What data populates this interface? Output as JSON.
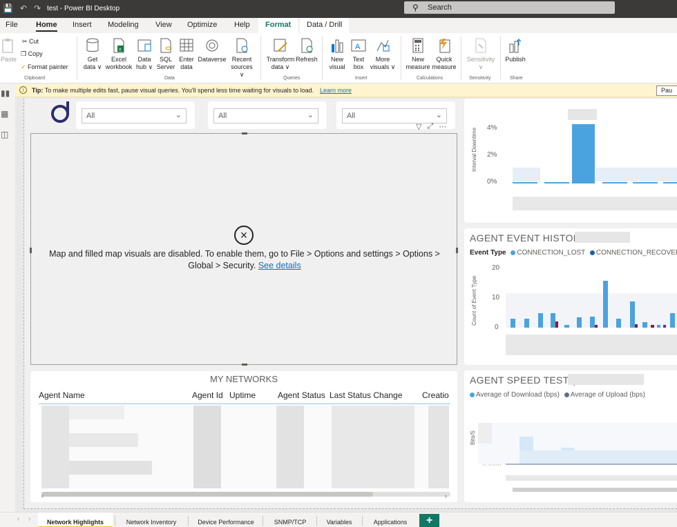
{
  "titlebar": {
    "title": "test - Power BI Desktop",
    "search_placeholder": "Search"
  },
  "menu": {
    "items": [
      "File",
      "Home",
      "Insert",
      "Modeling",
      "View",
      "Optimize",
      "Help"
    ],
    "active": "Home",
    "context_tabs": [
      "Format",
      "Data / Drill"
    ]
  },
  "ribbon": {
    "clipboard": {
      "paste": "Paste",
      "cut": "Cut",
      "copy": "Copy",
      "format_painter": "Format painter",
      "label": "Clipboard"
    },
    "data": {
      "get_data": [
        "Get",
        "data ∨"
      ],
      "excel": [
        "Excel",
        "workbook"
      ],
      "data_hub": [
        "Data",
        "hub ∨"
      ],
      "sql": [
        "SQL",
        "Server"
      ],
      "enter_data": [
        "Enter",
        "data"
      ],
      "dataverse": "Dataverse",
      "recent": [
        "Recent",
        "sources ∨"
      ],
      "label": "Data"
    },
    "queries": {
      "transform": [
        "Transform",
        "data ∨"
      ],
      "refresh": "Refresh",
      "label": "Queries"
    },
    "insert": {
      "new_visual": [
        "New",
        "visual"
      ],
      "text_box": [
        "Text",
        "box"
      ],
      "more_visuals": [
        "More",
        "visuals ∨"
      ],
      "label": "Insert"
    },
    "calculations": {
      "new_measure": [
        "New",
        "measure"
      ],
      "quick_measure": [
        "Quick",
        "measure"
      ],
      "label": "Calculations"
    },
    "sensitivity": {
      "sensitivity": "Sensitivity",
      "caret": "∨",
      "label": "Sensitivity"
    },
    "share": {
      "publish": "Publish",
      "label": "Share"
    }
  },
  "tip": {
    "label": "Tip:",
    "text": "To make multiple edits fast, pause visual queries. You'll spend less time waiting for visuals to load.",
    "link": "Learn more",
    "pause_button": "Pau"
  },
  "slicers": [
    {
      "value": "All"
    },
    {
      "value": "All"
    },
    {
      "value": "All"
    }
  ],
  "map_visual": {
    "message": "Map and filled map visuals are disabled. To enable them, go to File > Options and settings > Options > Global > Security.",
    "link": "See details"
  },
  "table_visual": {
    "title": "MY NETWORKS",
    "columns": [
      "Agent Name",
      "Agent Id",
      "Uptime",
      "Agent Status",
      "Last Status Change",
      "Creatio"
    ]
  },
  "downtime_chart": {
    "ylabel": "Interval Downtime",
    "yticks": [
      "4%",
      "2%",
      "0%"
    ]
  },
  "event_chart": {
    "title": "AGENT EVENT HISTORY",
    "legend_title": "Event Type",
    "legend": [
      {
        "name": "CONNECTION_LOST",
        "color": "#4aa3df"
      },
      {
        "name": "CONNECTION_RECOVERED",
        "color": "#1f5fa8"
      }
    ],
    "ylabel": "Count of Event Type",
    "yticks": [
      "20",
      "10",
      "0"
    ]
  },
  "speed_chart": {
    "title": "AGENT SPEED TEST (",
    "legend": [
      {
        "name": "Average of Download (bps)",
        "color": "#4aa3df"
      },
      {
        "name": "Average of Upload (bps)",
        "color": "#5a6e8c"
      }
    ],
    "ylabel": "Bits/S",
    "ytick": "0.00M"
  },
  "page_tabs": [
    "Network Highlights",
    "Network Inventory",
    "Device Performance",
    "SNMP/TCP",
    "Variables",
    "Applications"
  ],
  "active_page": "Network Highlights",
  "add_page": "+"
}
